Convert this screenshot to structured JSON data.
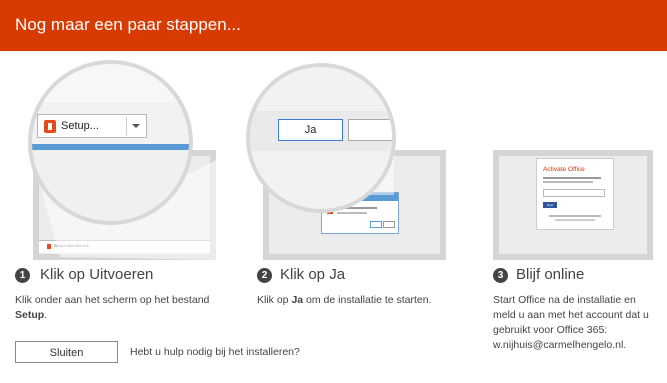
{
  "header": {
    "title": "Nog maar een paar stappen..."
  },
  "step1": {
    "number": "1",
    "title": "Klik op Uitvoeren",
    "desc_pre": "Klik onder aan het scherm op het bestand ",
    "desc_bold": "Setup",
    "desc_post": ".",
    "setup_label": "Setup...",
    "download_label": "SetupOffice365.exe"
  },
  "step2": {
    "number": "2",
    "title": "Klik op Ja",
    "desc_pre": "Klik op ",
    "desc_bold": "Ja",
    "desc_post": " om de installatie te starten.",
    "ja_label": "Ja"
  },
  "step3": {
    "number": "3",
    "title": "Blijf online",
    "desc": "Start Office na de installatie en meld u aan met het account dat u gebruikt voor Office 365: w.nijhuis@carmelhengelo.nl.",
    "dialog_title": "Activate Office",
    "dialog_button": "Next"
  },
  "footer": {
    "close_label": "Sluiten",
    "help_text": "Hebt u hulp nodig bij het installeren?"
  },
  "colors": {
    "header": "#d83b01",
    "office_orange": "#e64a19",
    "browser_blue": "#5b9bd5"
  }
}
